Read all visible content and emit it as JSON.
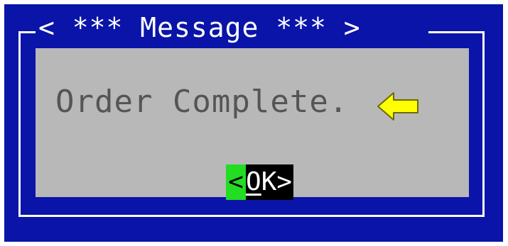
{
  "dialog": {
    "title": "< *** Message *** >",
    "message": "Order Complete.",
    "ok_button": {
      "left_bracket": "<",
      "hotkey": "O",
      "rest": "K>"
    }
  },
  "icons": {
    "pointer": "arrow-left-icon"
  },
  "colors": {
    "background": "#0a14a8",
    "panel": "#b8b8b8",
    "text": "#555555",
    "frame": "#ffffff",
    "button_focus": "#22dd22",
    "button_bg": "#000000",
    "arrow": "#ffff00"
  }
}
